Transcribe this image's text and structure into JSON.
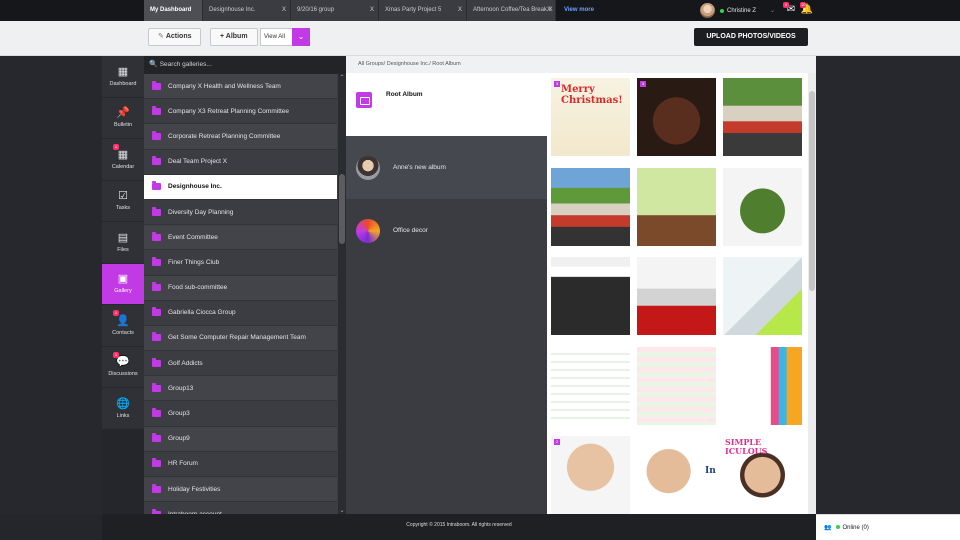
{
  "tabs": [
    {
      "label": "My Dashboard",
      "closable": false
    },
    {
      "label": "Designhouse Inc.",
      "closable": true
    },
    {
      "label": "9/20/16 group",
      "closable": true
    },
    {
      "label": "Xmas Party Project 5",
      "closable": true
    },
    {
      "label": "Afternoon Coffee/Tea Break X",
      "closable": true
    }
  ],
  "view_more": "View more",
  "user": {
    "name": "Christine Z",
    "mail_count": "0",
    "notif_count": "10"
  },
  "toolbar": {
    "actions": "Actions",
    "album": "+ Album",
    "view_all": "View All",
    "upload": "UPLOAD PHOTOS/VIDEOS"
  },
  "nav": [
    {
      "label": "Dashboard",
      "icon": "grid-icon"
    },
    {
      "label": "Bulletin",
      "icon": "pin-icon"
    },
    {
      "label": "Calendar",
      "icon": "calendar-icon",
      "badge": "1"
    },
    {
      "label": "Tasks",
      "icon": "checklist-icon"
    },
    {
      "label": "Files",
      "icon": "file-icon"
    },
    {
      "label": "Gallery",
      "icon": "gallery-icon",
      "active": true
    },
    {
      "label": "Contacts",
      "icon": "person-icon",
      "badge": "1"
    },
    {
      "label": "Discussions",
      "icon": "discussion-icon",
      "badge": "1"
    },
    {
      "label": "Links",
      "icon": "globe-icon"
    }
  ],
  "search_placeholder": "Search galleries...",
  "galleries": [
    "Company X Health and Wellness Team",
    "Company X3 Retreat Planning Committee",
    "Corporate Retreat Planning Committee",
    "Deal Team Project X",
    "Designhouse Inc.",
    "Diversity Day Planning",
    "Event Committee",
    "Finer Things Club",
    "Food sub-committee",
    "Gabriella Ciocca Group",
    "Get Some Computer Repair Management Team",
    "Golf Addicts",
    "Group13",
    "Group3",
    "Group9",
    "HR Forum",
    "Holiday Festivities",
    "Intraboom account"
  ],
  "selected_gallery": "Designhouse Inc.",
  "breadcrumb": "All Groups/ Designhouse Inc./ Root Album",
  "albums": [
    {
      "name": "Root Album"
    },
    {
      "name": "Anne's new album"
    },
    {
      "name": "Office decor"
    }
  ],
  "photos": [
    {
      "caption": "Merry Christmas!",
      "badge": "3"
    },
    {
      "caption": "",
      "badge": "3"
    },
    {
      "caption": ""
    },
    {
      "caption": ""
    },
    {
      "caption": ""
    },
    {
      "caption": ""
    },
    {
      "caption": ""
    },
    {
      "caption": ""
    },
    {
      "caption": ""
    },
    {
      "caption": ""
    },
    {
      "caption": ""
    },
    {
      "caption": ""
    },
    {
      "caption": "",
      "badge": "2"
    },
    {
      "caption": "In"
    },
    {
      "caption": "SIMPLE ICULOUS"
    }
  ],
  "footer": "Copyright © 2015 Intraboom. All rights reserved",
  "online": "Online (0)",
  "colors": {
    "accent": "#c23ae5",
    "online": "#33d14d",
    "badge": "#ff2f6c"
  }
}
